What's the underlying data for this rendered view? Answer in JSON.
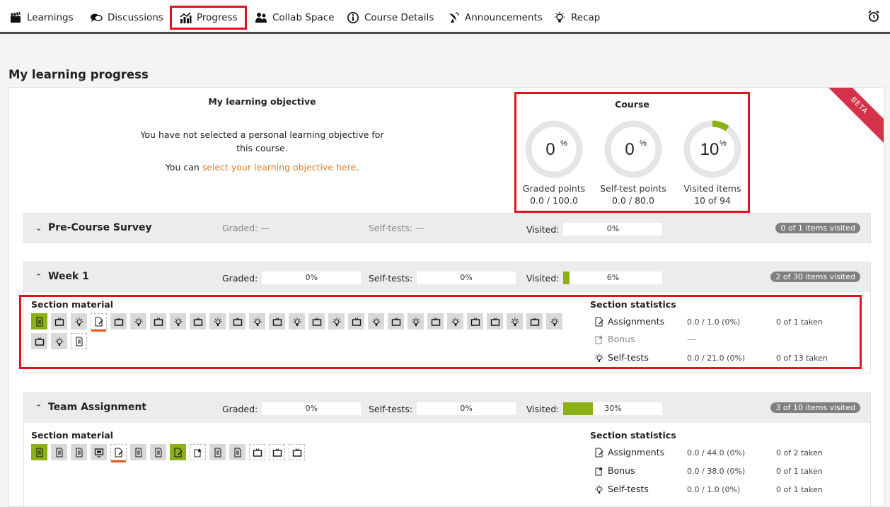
{
  "nav": {
    "items": [
      {
        "label": "Learnings",
        "icon": "clapperboard-icon"
      },
      {
        "label": "Discussions",
        "icon": "chat-bubbles-icon"
      },
      {
        "label": "Progress",
        "icon": "bar-chart-icon",
        "active": true
      },
      {
        "label": "Collab Space",
        "icon": "people-icon"
      },
      {
        "label": "Course Details",
        "icon": "info-icon"
      },
      {
        "label": "Announcements",
        "icon": "satellite-dish-icon"
      },
      {
        "label": "Recap",
        "icon": "lightbulb-icon"
      }
    ],
    "alarm_icon": "alarm-clock-icon"
  },
  "page": {
    "title": "My learning progress",
    "beta_label": "BETA"
  },
  "objective": {
    "heading": "My learning objective",
    "message": "You have not selected a personal learning objective for this course.",
    "prompt_prefix": "You can ",
    "link_text": "select your learning objective here",
    "prompt_suffix": "."
  },
  "course": {
    "heading": "Course",
    "gauges": [
      {
        "value": "0",
        "unit": "%",
        "fraction": 0,
        "label": "Graded points",
        "sub": "0.0 / 100.0"
      },
      {
        "value": "0",
        "unit": "%",
        "fraction": 0,
        "label": "Self-test points",
        "sub": "0.0 / 80.0"
      },
      {
        "value": "10",
        "unit": "%",
        "fraction": 0.1,
        "label": "Visited items",
        "sub": "10 of 94"
      }
    ]
  },
  "sections": [
    {
      "title": "Pre-Course Survey",
      "collapsed": true,
      "graded": {
        "label": "Graded: —"
      },
      "selftests": {
        "label": "Self-tests: —"
      },
      "visited": {
        "label": "Visited:",
        "pct": "0%",
        "fraction": 0
      },
      "pill": "0 of 1 items visited"
    },
    {
      "title": "Week 1",
      "collapsed": false,
      "graded": {
        "label": "Graded:",
        "pct": "0%",
        "fraction": 0
      },
      "selftests": {
        "label": "Self-tests:",
        "pct": "0%",
        "fraction": 0
      },
      "visited": {
        "label": "Visited:",
        "pct": "6%",
        "fraction": 0.06
      },
      "pill": "2 of 30 items visited",
      "material_title": "Section material",
      "stats_title": "Section statistics",
      "stats": [
        {
          "label": "Assignments",
          "icon": "assignment-icon",
          "value": "0.0 / 1.0 (0%)",
          "taken": "0 of 1 taken"
        },
        {
          "label": "Bonus",
          "icon": "bonus-icon",
          "value": "—",
          "taken": "",
          "dim": true
        },
        {
          "label": "Self-tests",
          "icon": "lightbulb-icon",
          "value": "0.0 / 21.0 (0%)",
          "taken": "0 of 13 taken"
        }
      ]
    },
    {
      "title": "Team Assignment",
      "collapsed": false,
      "graded": {
        "label": "Graded:",
        "pct": "0%",
        "fraction": 0
      },
      "selftests": {
        "label": "Self-tests:",
        "pct": "0%",
        "fraction": 0
      },
      "visited": {
        "label": "Visited:",
        "pct": "30%",
        "fraction": 0.3
      },
      "pill": "3 of 10 items visited",
      "material_title": "Section material",
      "stats_title": "Section statistics",
      "stats": [
        {
          "label": "Assignments",
          "icon": "assignment-icon",
          "value": "0.0 / 44.0 (0%)",
          "taken": "0 of 2 taken"
        },
        {
          "label": "Bonus",
          "icon": "bonus-icon",
          "value": "0.0 / 38.0 (0%)",
          "taken": "0 of 1 taken"
        },
        {
          "label": "Self-tests",
          "icon": "lightbulb-icon",
          "value": "0.0 / 1.0 (0%)",
          "taken": "0 of 1 taken"
        }
      ]
    }
  ]
}
